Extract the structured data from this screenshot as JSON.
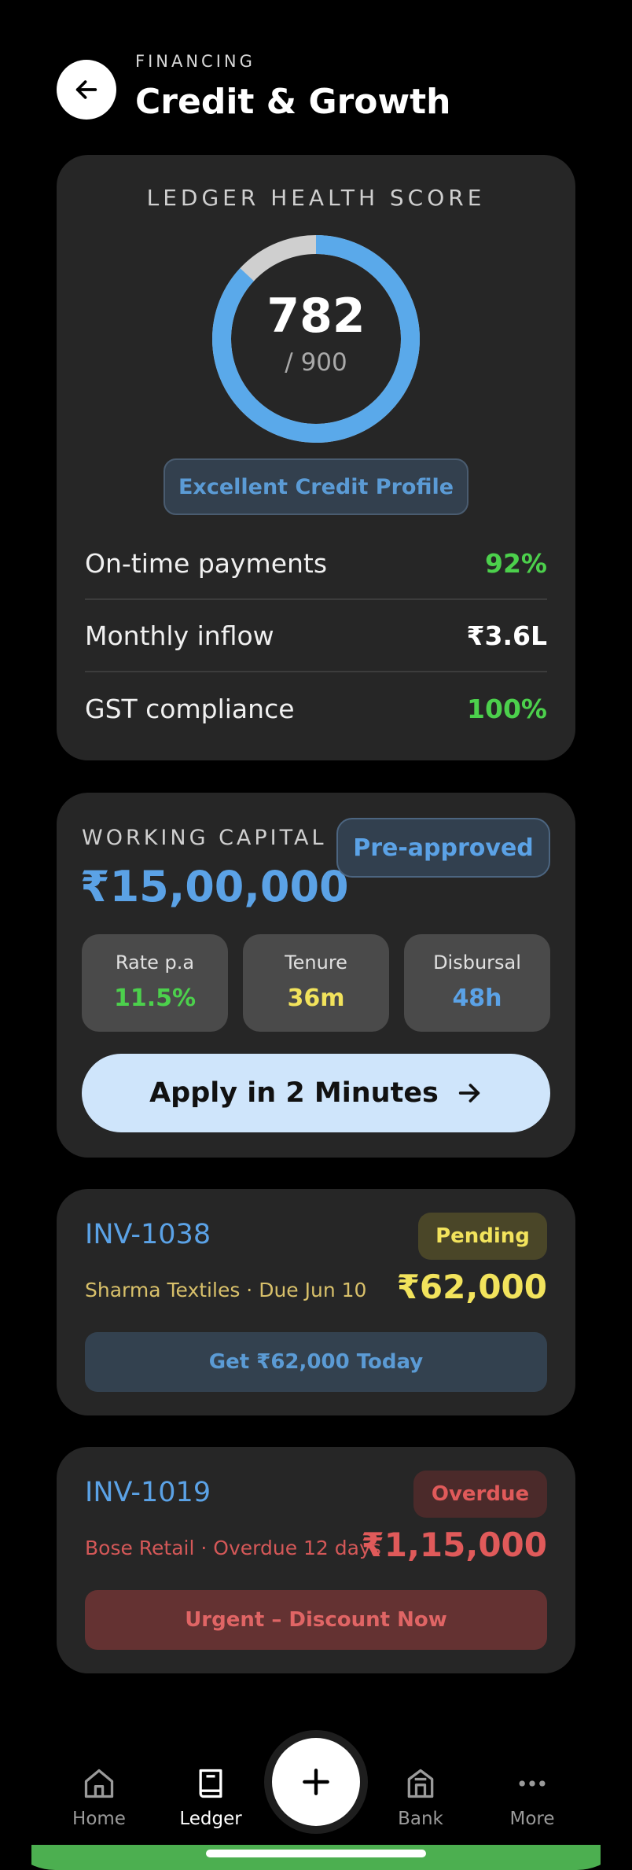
{
  "header": {
    "eyebrow": "FINANCING",
    "title": "Credit & Growth"
  },
  "score": {
    "label": "LEDGER HEALTH SCORE",
    "value": "782",
    "max": "/ 900",
    "fraction": 0.869,
    "badge": "Excellent Credit Profile",
    "metrics": [
      {
        "label": "On-time payments",
        "value": "92%",
        "color": "#4cd04c"
      },
      {
        "label": "Monthly inflow",
        "value": "₹3.6L",
        "color": "#ffffff"
      },
      {
        "label": "GST compliance",
        "value": "100%",
        "color": "#4cd04c"
      }
    ]
  },
  "working_capital": {
    "label": "WORKING CAPITAL",
    "amount": "₹15,00,000",
    "badge": "Pre-approved",
    "stats": [
      {
        "label": "Rate p.a",
        "value": "11.5%",
        "color": "#4cd04c"
      },
      {
        "label": "Tenure",
        "value": "36m",
        "color": "#f2e35c"
      },
      {
        "label": "Disbursal",
        "value": "48h",
        "color": "#5ba2e6"
      }
    ],
    "cta": "Apply in 2 Minutes"
  },
  "invoices": [
    {
      "id": "INV-1038",
      "status": "Pending",
      "subtitle": "Sharma Textiles · Due Jun 10",
      "amount": "₹62,000",
      "action": "Get ₹62,000 Today"
    },
    {
      "id": "INV-1019",
      "status": "Overdue",
      "subtitle": "Bose Retail · Overdue 12 days",
      "amount": "₹1,15,000",
      "action": "Urgent – Discount Now"
    }
  ],
  "nav": {
    "home": "Home",
    "ledger": "Ledger",
    "bank": "Bank",
    "more": "More",
    "active": "Ledger"
  },
  "colors": {
    "accent_blue": "#5ba2e6",
    "success_green": "#4cd04c",
    "pending_yellow": "#f2e35c",
    "overdue_red": "#e05a5a"
  }
}
